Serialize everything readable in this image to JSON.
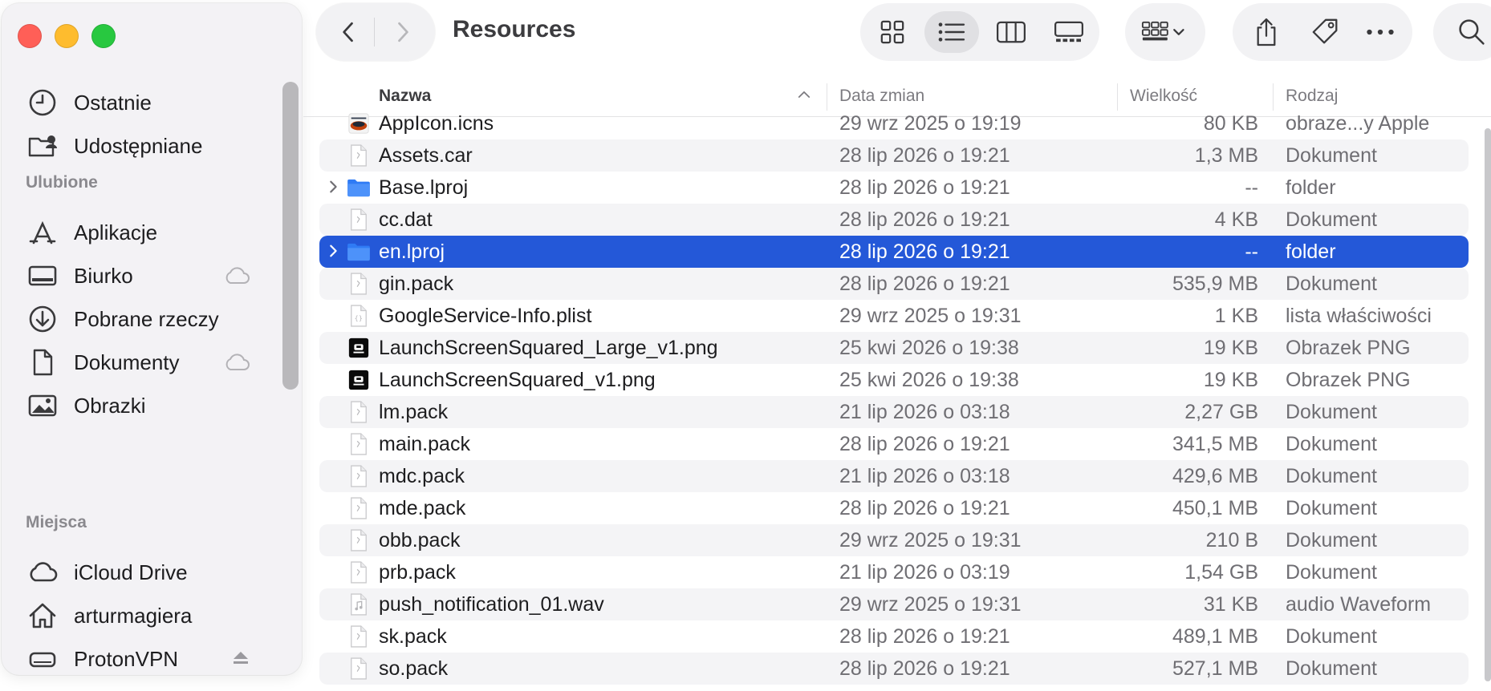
{
  "window": {
    "title": "Resources"
  },
  "sidebar": {
    "sections": {
      "favorites": "Ulubione",
      "places": "Miejsca"
    },
    "top_items": [
      {
        "label": "Ostatnie",
        "icon": "clock-icon"
      },
      {
        "label": "Udostępniane",
        "icon": "shared-folder-icon"
      }
    ],
    "favorites": [
      {
        "label": "Aplikacje",
        "icon": "applications-icon",
        "cloud": false
      },
      {
        "label": "Biurko",
        "icon": "desktop-icon",
        "cloud": true
      },
      {
        "label": "Pobrane rzeczy",
        "icon": "download-icon",
        "cloud": false
      },
      {
        "label": "Dokumenty",
        "icon": "document-icon",
        "cloud": true
      },
      {
        "label": "Obrazki",
        "icon": "pictures-icon",
        "cloud": false
      }
    ],
    "places": [
      {
        "label": "iCloud Drive",
        "icon": "icloud-icon"
      },
      {
        "label": "arturmagiera",
        "icon": "home-icon"
      },
      {
        "label": "ProtonVPN",
        "icon": "drive-icon",
        "eject": true
      }
    ]
  },
  "columns": {
    "name": "Nazwa",
    "date": "Data zmian",
    "size": "Wielkość",
    "kind": "Rodzaj"
  },
  "files": [
    {
      "name": "AppIcon.icns",
      "date": "29 wrz 2025 o 19:19",
      "size": "80 KB",
      "kind": "obraze...y Apple",
      "type": "icns"
    },
    {
      "name": "Assets.car",
      "date": "28 lip 2026 o 19:21",
      "size": "1,3 MB",
      "kind": "Dokument",
      "type": "doc"
    },
    {
      "name": "Base.lproj",
      "date": "28 lip 2026 o 19:21",
      "size": "--",
      "kind": "folder",
      "type": "folder"
    },
    {
      "name": "cc.dat",
      "date": "28 lip 2026 o 19:21",
      "size": "4 KB",
      "kind": "Dokument",
      "type": "doc"
    },
    {
      "name": "en.lproj",
      "date": "28 lip 2026 o 19:21",
      "size": "--",
      "kind": "folder",
      "type": "folder",
      "selected": true
    },
    {
      "name": "gin.pack",
      "date": "28 lip 2026 o 19:21",
      "size": "535,9 MB",
      "kind": "Dokument",
      "type": "doc"
    },
    {
      "name": "GoogleService-Info.plist",
      "date": "29 wrz 2025 o 19:31",
      "size": "1 KB",
      "kind": "lista właściwości",
      "type": "plist"
    },
    {
      "name": "LaunchScreenSquared_Large_v1.png",
      "date": "25 kwi 2026 o 19:38",
      "size": "19 KB",
      "kind": "Obrazek PNG",
      "type": "png"
    },
    {
      "name": "LaunchScreenSquared_v1.png",
      "date": "25 kwi 2026 o 19:38",
      "size": "19 KB",
      "kind": "Obrazek PNG",
      "type": "png"
    },
    {
      "name": "lm.pack",
      "date": "21 lip 2026 o 03:18",
      "size": "2,27 GB",
      "kind": "Dokument",
      "type": "doc"
    },
    {
      "name": "main.pack",
      "date": "28 lip 2026 o 19:21",
      "size": "341,5 MB",
      "kind": "Dokument",
      "type": "doc"
    },
    {
      "name": "mdc.pack",
      "date": "21 lip 2026 o 03:18",
      "size": "429,6 MB",
      "kind": "Dokument",
      "type": "doc"
    },
    {
      "name": "mde.pack",
      "date": "28 lip 2026 o 19:21",
      "size": "450,1 MB",
      "kind": "Dokument",
      "type": "doc"
    },
    {
      "name": "obb.pack",
      "date": "29 wrz 2025 o 19:31",
      "size": "210 B",
      "kind": "Dokument",
      "type": "doc"
    },
    {
      "name": "prb.pack",
      "date": "21 lip 2026 o 03:19",
      "size": "1,54 GB",
      "kind": "Dokument",
      "type": "doc"
    },
    {
      "name": "push_notification_01.wav",
      "date": "29 wrz 2025 o 19:31",
      "size": "31 KB",
      "kind": "audio Waveform",
      "type": "audio"
    },
    {
      "name": "sk.pack",
      "date": "28 lip 2026 o 19:21",
      "size": "489,1 MB",
      "kind": "Dokument",
      "type": "doc"
    },
    {
      "name": "so.pack",
      "date": "28 lip 2026 o 19:21",
      "size": "527,1 MB",
      "kind": "Dokument",
      "type": "doc"
    }
  ],
  "colors": {
    "selection": "#2458d8",
    "folder": "#2f7bf5",
    "sidebar_bg": "#f3f2f5"
  }
}
